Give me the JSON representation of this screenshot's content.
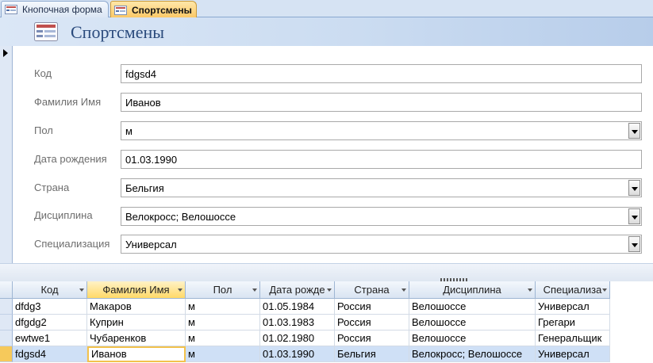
{
  "tabs": [
    {
      "label": "Кнопочная форма",
      "active": false
    },
    {
      "label": "Спортсмены",
      "active": true
    }
  ],
  "form": {
    "title": "Спортсмены",
    "fields": [
      {
        "label": "Код",
        "value": "fdgsd4",
        "type": "text"
      },
      {
        "label": "Фамилия Имя",
        "value": "Иванов",
        "type": "text"
      },
      {
        "label": "Пол",
        "value": "м",
        "type": "combo"
      },
      {
        "label": "Дата рождения",
        "value": "01.03.1990",
        "type": "text"
      },
      {
        "label": "Страна",
        "value": "Бельгия",
        "type": "combo"
      },
      {
        "label": "Дисциплина",
        "value": "Велокросс; Велошоссе",
        "type": "combo"
      },
      {
        "label": "Специализация",
        "value": "Универсал",
        "type": "combo"
      }
    ]
  },
  "datasheet": {
    "columns": [
      "Код",
      "Фамилия Имя",
      "Пол",
      "Дата рожде",
      "Страна",
      "Дисциплина",
      "Специализа"
    ],
    "selected_column": 1,
    "rows": [
      [
        "dfdg3",
        "Макаров",
        "м",
        "01.05.1984",
        "Россия",
        "Велошоссе",
        "Универсал"
      ],
      [
        "dfgdg2",
        "Куприн",
        "м",
        "01.03.1983",
        "Россия",
        "Велошоссе",
        "Грегари"
      ],
      [
        "ewtwe1",
        "Чубаренков",
        "м",
        "01.02.1980",
        "Россия",
        "Велошоссе",
        "Генеральщик"
      ],
      [
        "fdgsd4",
        "Иванов",
        "м",
        "01.03.1990",
        "Бельгия",
        "Велокросс; Велошоссе",
        "Универсал"
      ]
    ],
    "current_row": 3
  },
  "colors": {
    "accent": "#f6c95b",
    "header_text": "#2a4a7c"
  }
}
